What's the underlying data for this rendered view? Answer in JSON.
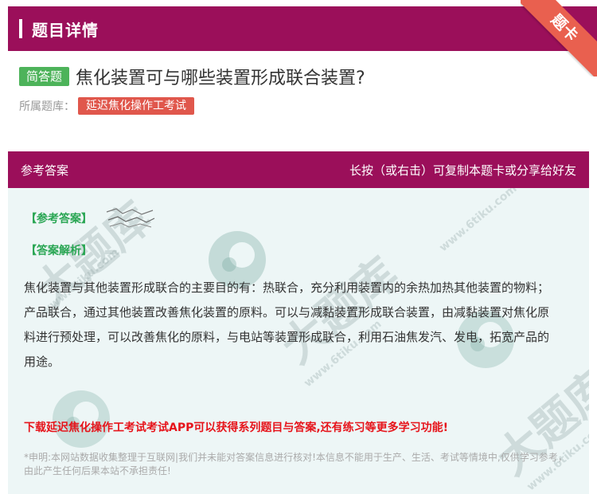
{
  "header": {
    "title": "题目详情",
    "ribbon_label": "题卡"
  },
  "question": {
    "type_tag": "简答题",
    "title": "焦化装置可与哪些装置形成联合装置?",
    "bank_label": "所属题库：",
    "bank_name": "延迟焦化操作工考试"
  },
  "answer_panel": {
    "header_left": "参考答案",
    "header_right": "长按（或右击）可复制本题卡或分享给好友",
    "ref_label": "【参考答案】",
    "analysis_label": "【答案解析】",
    "text": "焦化装置与其他装置形成联合的主要目的有：热联合，充分利用装置内的余热加热其他装置的物料；产品联合，通过其他装置改善焦化装置的原料。可以与减黏装置形成联合装置，由减黏装置对焦化原料进行预处理，可以改善焦化的原料，与电站等装置形成联合，利用石油焦发汽、发电，拓宽产品的用途。",
    "promo": "下载延迟焦化操作工考试考试APP可以获得系列题目与答案,还有练习等更多学习功能!",
    "disclaimer": "*申明:本网站数据收集整理于互联网|我们并未能对答案信息进行核对!本信息不能用于生产、生活、考试等情境中,仅供学习参考，由此产生任何后果本站不承担责任!"
  },
  "watermark": {
    "brand": "大题库",
    "url": "www.6tiku.com"
  },
  "colors": {
    "header_bg": "#9b0f5a",
    "ribbon": "#e9604f",
    "tag_green": "#4db35a",
    "tag_red": "#e0574c",
    "panel_bg": "#edf6f6",
    "promo": "#e6141b"
  }
}
